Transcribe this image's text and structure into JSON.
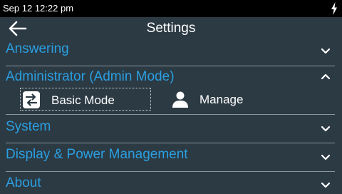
{
  "status_bar": {
    "time": "Sep 12 12:22 pm",
    "charging_icon": "lightning-bolt-icon"
  },
  "header": {
    "title": "Settings",
    "back_icon": "back-arrow-icon"
  },
  "menu": {
    "answering": {
      "label": "Answering",
      "expanded": false
    },
    "administrator": {
      "label": "Administrator (Admin Mode)",
      "expanded": true,
      "options": [
        {
          "label": "Basic Mode",
          "icon": "swap-icon",
          "focused": true
        },
        {
          "label": "Manage",
          "icon": "person-icon",
          "focused": false
        }
      ]
    },
    "system": {
      "label": "System",
      "expanded": false
    },
    "display_power": {
      "label": "Display & Power Management",
      "expanded": false
    },
    "about": {
      "label": "About",
      "expanded": false
    }
  },
  "colors": {
    "background": "#2c3a44",
    "accent": "#2a9fe0",
    "status_bar": "#000000",
    "text": "#ffffff"
  }
}
